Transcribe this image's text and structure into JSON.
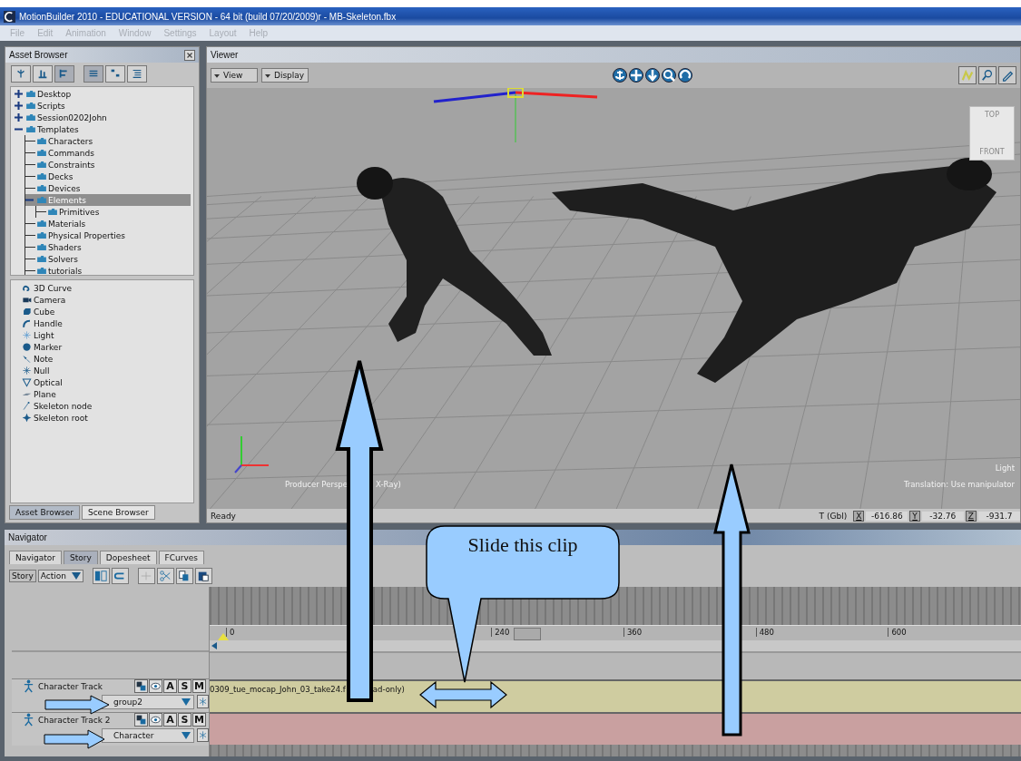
{
  "window": {
    "title": "MotionBuilder 2010 - EDUCATIONAL VERSION   - 64 bit (build 07/20/2009)r  - MB-Skeleton.fbx"
  },
  "menu": [
    "File",
    "Edit",
    "Animation",
    "Window",
    "Settings",
    "Layout",
    "Help"
  ],
  "asset_browser": {
    "title": "Asset Browser",
    "tree": [
      {
        "label": "Desktop",
        "expanded": false,
        "selected": false
      },
      {
        "label": "Scripts",
        "expanded": false,
        "selected": false
      },
      {
        "label": "Session0202John",
        "expanded": false,
        "selected": false
      },
      {
        "label": "Templates",
        "expanded": true,
        "selected": false,
        "children": [
          {
            "label": "Characters",
            "selected": false
          },
          {
            "label": "Commands",
            "selected": false
          },
          {
            "label": "Constraints",
            "selected": false
          },
          {
            "label": "Decks",
            "selected": false
          },
          {
            "label": "Devices",
            "selected": false
          },
          {
            "label": "Elements",
            "expanded": true,
            "selected": true,
            "children": [
              {
                "label": "Primitives",
                "selected": false
              }
            ]
          },
          {
            "label": "Materials",
            "selected": false
          },
          {
            "label": "Physical Properties",
            "selected": false
          },
          {
            "label": "Shaders",
            "selected": false
          },
          {
            "label": "Solvers",
            "selected": false
          },
          {
            "label": "tutorials",
            "selected": false
          }
        ]
      }
    ],
    "elements": [
      {
        "label": "3D Curve",
        "kind": "curve"
      },
      {
        "label": "Camera",
        "kind": "camera"
      },
      {
        "label": "Cube",
        "kind": "cube"
      },
      {
        "label": "Handle",
        "kind": "handle"
      },
      {
        "label": "Light",
        "kind": "light"
      },
      {
        "label": "Marker",
        "kind": "marker"
      },
      {
        "label": "Note",
        "kind": "note"
      },
      {
        "label": "Null",
        "kind": "null"
      },
      {
        "label": "Optical",
        "kind": "optical"
      },
      {
        "label": "Plane",
        "kind": "plane"
      },
      {
        "label": "Skeleton node",
        "kind": "node"
      },
      {
        "label": "Skeleton root",
        "kind": "root"
      }
    ],
    "tabs": [
      {
        "label": "Asset Browser",
        "selected": true
      },
      {
        "label": "Scene Browser",
        "selected": false
      }
    ]
  },
  "viewer": {
    "title": "Viewer",
    "menus": [
      "View",
      "Display"
    ],
    "cube_labels": [
      "TOP",
      "FRONT"
    ],
    "camera_label": "Producer Perspe",
    "camera_label_tail": "X-Ray)",
    "light_label": "Light",
    "manipulator_label": "Translation: Use manipulator",
    "status": "Ready",
    "coord_label": "T (Gbl)",
    "coords": [
      {
        "axis": "X",
        "value": "-616.86"
      },
      {
        "axis": "Y",
        "value": "-32.76"
      },
      {
        "axis": "Z",
        "value": "-931.7"
      }
    ]
  },
  "navigator": {
    "title": "Navigator",
    "tabs": [
      {
        "label": "Navigator",
        "selected": false
      },
      {
        "label": "Story",
        "selected": true
      },
      {
        "label": "Dopesheet",
        "selected": false
      },
      {
        "label": "FCurves",
        "selected": false
      }
    ],
    "mode": {
      "story": "Story",
      "action": "Action"
    },
    "ruler": [
      "0",
      "240",
      "360",
      "480",
      "600"
    ],
    "tracks": [
      {
        "name": "Character Track",
        "character": "group2",
        "buttons": [
          "A",
          "S",
          "M"
        ],
        "color": "#cfcca0",
        "clip": "0309_tue_mocap_John_03_take24.f",
        "clip_tail": "ad-only)"
      },
      {
        "name": "Character Track 2",
        "character": "Character",
        "buttons": [
          "A",
          "S",
          "M"
        ],
        "color": "#c9a0a0"
      }
    ]
  },
  "annotation": {
    "callout": "Slide this clip"
  }
}
